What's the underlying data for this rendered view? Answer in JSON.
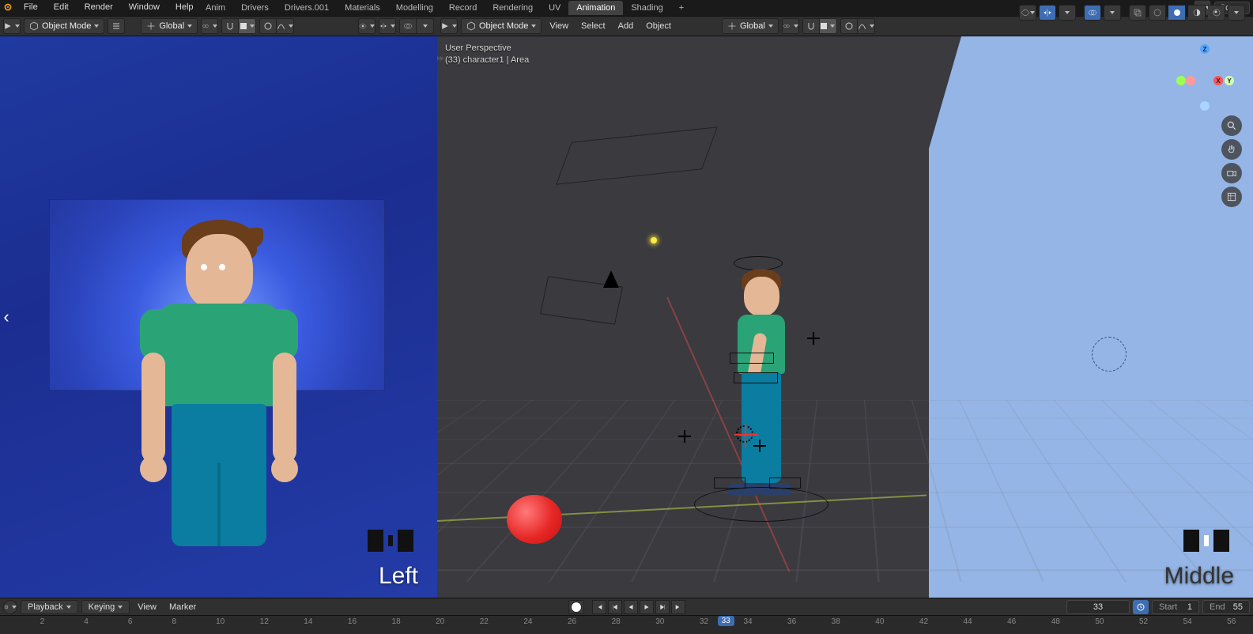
{
  "app": {
    "menus": [
      "File",
      "Edit",
      "Render",
      "Window",
      "Help"
    ],
    "workspaces": [
      "Anim",
      "Drivers",
      "Drivers.001",
      "Materials",
      "Modelling",
      "Record",
      "Rendering",
      "UV",
      "Animation",
      "Shading"
    ],
    "active_workspace": "Animation",
    "scene_label": "Scene"
  },
  "viewport_left": {
    "mode_label": "Object Mode",
    "orientation": "Global",
    "annotation": "Left"
  },
  "viewport_right": {
    "mode_label": "Object Mode",
    "menus": [
      "View",
      "Select",
      "Add",
      "Object"
    ],
    "orientation": "Global",
    "overlay_line1": "User Perspective",
    "overlay_line2": "(33) character1 | Area",
    "annotation": "Middle",
    "gizmo": {
      "x": "X",
      "y": "Y",
      "z": "Z"
    }
  },
  "timeline": {
    "menus_playback": "Playback",
    "menus_keying": "Keying",
    "menus_view": "View",
    "menus_marker": "Marker",
    "current_frame_display": "33",
    "start_label": "Start",
    "start_value": "1",
    "end_label": "End",
    "end_value": "55",
    "frame_field": "33",
    "ticks": [
      "2",
      "4",
      "6",
      "8",
      "10",
      "12",
      "14",
      "16",
      "18",
      "20",
      "22",
      "24",
      "26",
      "28",
      "30",
      "32",
      "33",
      "34",
      "36",
      "38",
      "40",
      "42",
      "44",
      "46",
      "48",
      "50",
      "52",
      "54",
      "56"
    ]
  }
}
